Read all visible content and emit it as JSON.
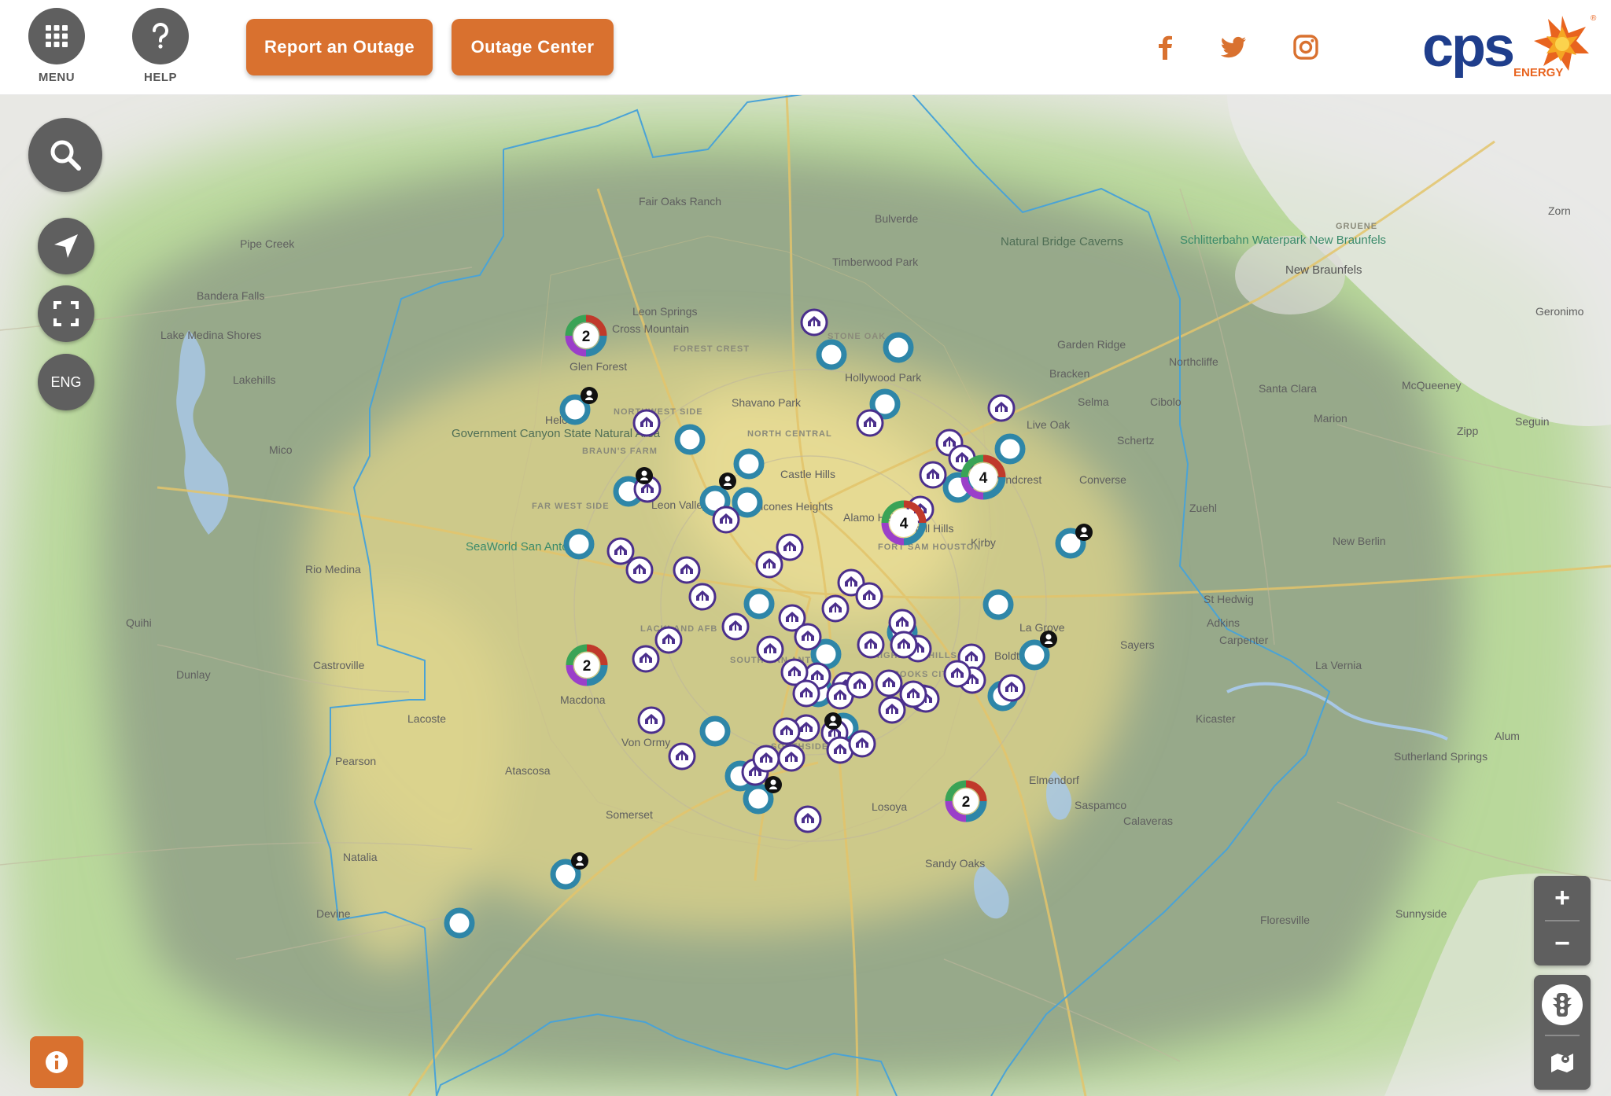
{
  "header": {
    "menu_label": "MENU",
    "help_label": "HELP",
    "report_outage_label": "Report an Outage",
    "outage_center_label": "Outage Center",
    "social": [
      "facebook-icon",
      "twitter-icon",
      "instagram-icon"
    ],
    "logo_text": "cps",
    "logo_sub": "ENERGY",
    "logo_mark": "®"
  },
  "colors": {
    "accent": "#d9712f",
    "control_gray": "#5f5f5f",
    "logo_blue": "#1f3e8c",
    "outage_purple": "#4b2f8c",
    "crew_teal": "#2e86a8",
    "boundary_blue": "#4aa3d6"
  },
  "controls": {
    "search_icon": "search-icon",
    "locate_icon": "navigation-arrow-icon",
    "fullscreen_icon": "fullscreen-icon",
    "language_label": "ENG",
    "zoom_in": "+",
    "zoom_out": "−",
    "info_icon": "info-icon",
    "traffic_icon": "traffic-light-icon",
    "map_layers_icon": "map-layers-icon"
  },
  "map": {
    "places": [
      "Fair Oaks Ranch",
      "Bulverde",
      "Timberwood Park",
      "Natural Bridge Caverns",
      "Schlitterbahn Waterpark New Braunfels",
      "GRUENE",
      "New Braunfels",
      "Zorn",
      "Geronimo",
      "Pipe Creek",
      "Bandera Falls",
      "Lake Medina Shores",
      "Lakehills",
      "Leon Springs",
      "Cross Mountain",
      "FOREST CREST",
      "STONE OAK",
      "Garden Ridge",
      "Northcliffe",
      "Bracken",
      "Selma",
      "Cibolo",
      "Santa Clara",
      "McQueeney",
      "Marion",
      "Seguin",
      "Zipp",
      "Shavano Park",
      "Helotes",
      "Government Canyon State Natural Area",
      "Mico",
      "NORTHWEST SIDE",
      "NORTH CENTRAL",
      "Live Oak",
      "Schertz",
      "BRAUN'S FARM",
      "Castle Hills",
      "Converse",
      "Leon Valley",
      "Alamo Heights",
      "Terrell Hills",
      "Zuehl",
      "FAR WEST SIDE",
      "SeaWorld San Antonio",
      "Kirby",
      "FORT SAM HOUSTON",
      "New Berlin",
      "Rio Medina",
      "St Hedwig",
      "Adkins",
      "Quihi",
      "LACKLAND AFB",
      "Sayers",
      "Carpenter",
      "Boldtville",
      "Castroville",
      "Dunlay",
      "La Vernia",
      "SOUTH SAN ANTONIO",
      "HIGHLAND HILLS",
      "BROOKS CITY BASE",
      "Macdona",
      "Lacoste",
      "Kicaster",
      "Von Ormy",
      "Alum",
      "SOUTHSIDE",
      "Pearson",
      "Atascosa",
      "Elmendorf",
      "Sutherland Springs",
      "Saspamco",
      "Somerset",
      "Losoya",
      "Calaveras",
      "Natalia",
      "Sandy Oaks",
      "Devine",
      "Floresville",
      "Sunnyside",
      "Glen Forest",
      "Hollywood Park",
      "Balcones Heights",
      "La Grove",
      "Windcrest"
    ],
    "cluster_counts": [
      "2",
      "2",
      "4",
      "4",
      "2"
    ]
  }
}
